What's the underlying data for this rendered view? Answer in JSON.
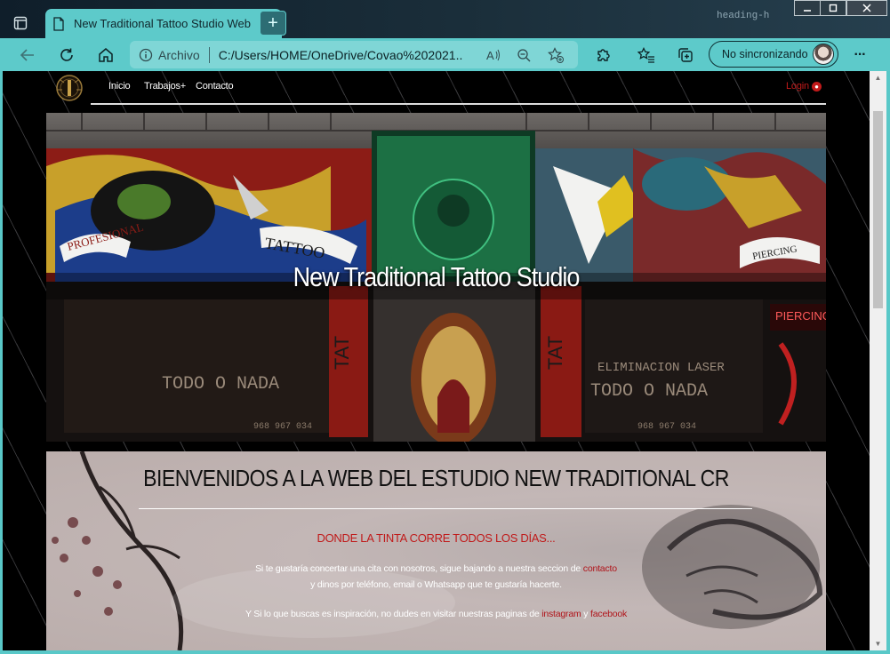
{
  "browser": {
    "tab_title": "New Traditional Tattoo Studio Web",
    "tab_close": "✕",
    "new_tab": "+",
    "background_text": "heading-h",
    "address_label": "Archivo",
    "url": "C:/Users/HOME/OneDrive/Covao%202021...",
    "profile_label": "No sincronizando",
    "more_label": "···"
  },
  "site": {
    "nav": {
      "inicio": "Inicio",
      "trabajos": "Trabajos+",
      "contacto": "Contacto",
      "login": "Login"
    },
    "hero_title": "New Traditional Tattoo Studio",
    "hero_signs": {
      "profesional": "PROFESIONAL",
      "tattoo": "TATTOO",
      "piercing": "PIERCING",
      "piercing_banner": "PIERCING",
      "todo_o_nada": "TODO O NADA",
      "phone": "968 967 034",
      "eliminacion": "ELIMINACION  LASER",
      "tat": "TAT"
    },
    "welcome": {
      "heading": "BIENVENIDOS A LA WEB DEL ESTUDIO NEW TRADITIONAL CR",
      "tagline": "DONDE LA TINTA CORRE TODOS LOS DÍAS...",
      "p1_text": "Si te gustaría concertar una cita con nosotros, sigue bajando a nuestra seccion de ",
      "p1_link": "contacto",
      "p2_text": "y dinos por teléfono, email o Whatsapp que te gustaría hacerte.",
      "p3_text": "Y Si lo que buscas es inspiración, no dudes en visitar nuestras paginas de ",
      "p3_link1": "instagram",
      "p3_mid": " y ",
      "p3_link2": "facebook"
    }
  },
  "colors": {
    "browser_accent": "#5dcaca",
    "link_red": "#c01a1a",
    "nav_bg": "#000000"
  }
}
